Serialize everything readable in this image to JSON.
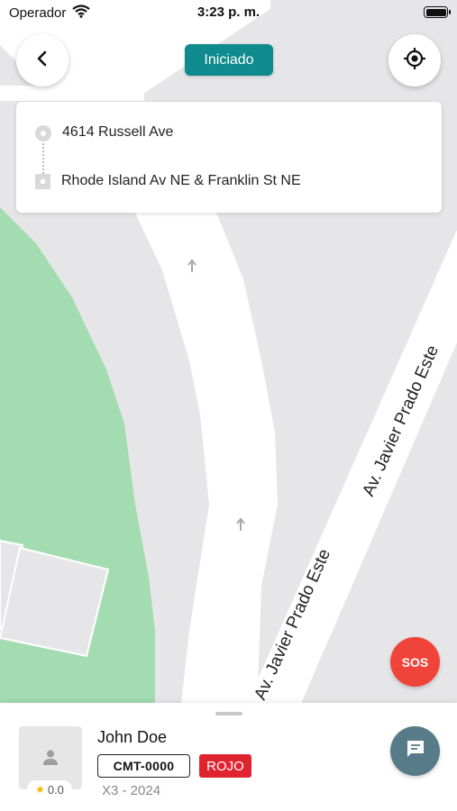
{
  "status_bar": {
    "carrier": "Operador",
    "time": "3:23 p. m."
  },
  "trip": {
    "status": "Iniciado",
    "status_color": "#0f8b8d"
  },
  "route": {
    "origin": "4614 Russell Ave",
    "destination": "Rhode Island Av NE & Franklin St NE"
  },
  "map": {
    "street_labels": [
      "Av. Javier Prado Este",
      "Av. Javier Prado Este"
    ]
  },
  "sos": {
    "label": "SOS",
    "color": "#f0443a"
  },
  "driver": {
    "name": "John Doe",
    "rating": "0.0",
    "plate": "CMT-0000",
    "vehicle_color": "ROJO",
    "vehicle_color_hex": "#e0242f",
    "vehicle": "X3 - 2024"
  },
  "icons": {
    "back": "chevron-left-icon",
    "locate": "crosshair-icon",
    "chat": "chat-icon",
    "avatar": "person-icon",
    "star": "star-icon"
  }
}
